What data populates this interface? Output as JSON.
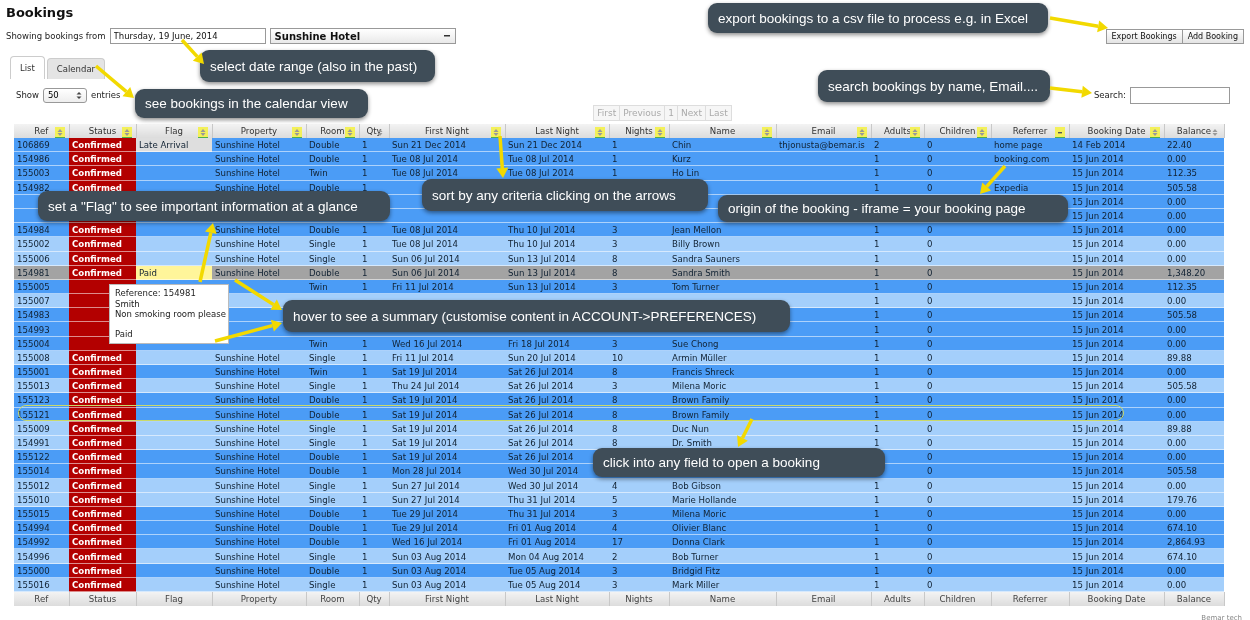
{
  "page_title": "Bookings",
  "filter": {
    "label": "Showing bookings from",
    "date": "Thursday, 19 June, 2014",
    "property": "Sunshine Hotel"
  },
  "actions": [
    "Export Bookings",
    "Add Booking"
  ],
  "tabs": [
    {
      "label": "List",
      "selected": true
    },
    {
      "label": "Calendar",
      "selected": false
    }
  ],
  "page_length": {
    "label_before": "Show",
    "value": "50",
    "label_after": "entries"
  },
  "pagination": [
    {
      "label": "First",
      "disabled": true
    },
    {
      "label": "Previous",
      "disabled": true
    },
    {
      "label": "1",
      "disabled": true
    },
    {
      "label": "Next",
      "disabled": true
    },
    {
      "label": "Last",
      "disabled": true
    }
  ],
  "search": {
    "label": "Search:"
  },
  "table": {
    "columns": [
      {
        "label": "Ref",
        "kind": "text",
        "sort_highlight": true,
        "sorted": false
      },
      {
        "label": "Status",
        "kind": "status",
        "sort_highlight": true,
        "sorted": false
      },
      {
        "label": "Flag",
        "kind": "flag",
        "sort_highlight": true,
        "sorted": false
      },
      {
        "label": "Property",
        "kind": "text",
        "sort_highlight": true,
        "sorted": false
      },
      {
        "label": "Room",
        "kind": "text",
        "sort_highlight": true,
        "sorted": false
      },
      {
        "label": "Qty",
        "kind": "text",
        "sort_highlight": false,
        "sorted": false
      },
      {
        "label": "First Night",
        "kind": "text",
        "sort_highlight": true,
        "sorted": false
      },
      {
        "label": "Last Night",
        "kind": "text",
        "sort_highlight": true,
        "sorted": false
      },
      {
        "label": "Nights",
        "kind": "text",
        "sort_highlight": true,
        "sorted": false
      },
      {
        "label": "Name",
        "kind": "text",
        "sort_highlight": true,
        "sorted": false
      },
      {
        "label": "Email",
        "kind": "text",
        "sort_highlight": true,
        "sorted": false
      },
      {
        "label": "Adults",
        "kind": "text",
        "sort_highlight": true,
        "sorted": false
      },
      {
        "label": "Children",
        "kind": "text",
        "sort_highlight": true,
        "sorted": false
      },
      {
        "label": "Referrer",
        "kind": "text",
        "sort_highlight": true,
        "sorted": true
      },
      {
        "label": "Booking Date",
        "kind": "text",
        "sort_highlight": true,
        "sorted": false
      },
      {
        "label": "Balance",
        "kind": "text",
        "sort_highlight": false,
        "sorted": false
      }
    ],
    "rows": [
      {
        "color": "#4b9cf6",
        "cells": {
          "ref": "106869",
          "status": "Confirmed",
          "flag": {
            "text": "Late Arrival",
            "color": "#dedede"
          },
          "property": "Sunshine Hotel",
          "room": "Double",
          "qty": "1",
          "first": "Sun 21 Dec 2014",
          "last": "Sun 21 Dec 2014",
          "nights": "1",
          "name": "Chin",
          "email": "thjonusta@bemar.is",
          "adults": "2",
          "children": "0",
          "referrer": "home page",
          "booked": "14 Feb 2014",
          "balance": "22.40"
        }
      },
      {
        "color": "#4b9cf6",
        "cells": {
          "ref": "154986",
          "status": "Confirmed",
          "property": "Sunshine Hotel",
          "room": "Double",
          "qty": "1",
          "first": "Tue 08 Jul 2014",
          "last": "Tue 08 Jul 2014",
          "nights": "1",
          "name": "Kurz",
          "adults": "1",
          "children": "0",
          "referrer": "booking.com",
          "booked": "15 Jun 2014",
          "balance": "0.00"
        }
      },
      {
        "color": "#4b9cf6",
        "cells": {
          "ref": "155003",
          "status": "Confirmed",
          "property": "Sunshine Hotel",
          "room": "Twin",
          "qty": "1",
          "first": "Tue 08 Jul 2014",
          "last": "Tue 08 Jul 2014",
          "nights": "1",
          "name": "Ho Lin",
          "adults": "1",
          "children": "0",
          "booked": "15 Jun 2014",
          "balance": "112.35"
        }
      },
      {
        "color": "#4b9cf6",
        "cells": {
          "ref": "154982",
          "status": "Confirmed",
          "property": "Sunshine Hotel",
          "room": "Double",
          "qty": "1",
          "adults": "1",
          "children": "0",
          "referrer": "Expedia",
          "booked": "15 Jun 2014",
          "balance": "505.58"
        }
      },
      {
        "color": "#4b9cf6",
        "cells": {
          "booked": "15 Jun 2014",
          "balance": "0.00"
        }
      },
      {
        "color": "#4b9cf6",
        "cells": {
          "booked": "15 Jun 2014",
          "balance": "0.00"
        }
      },
      {
        "color": "#4b9cf6",
        "cells": {
          "ref": "154984",
          "status": "Confirmed",
          "property": "Sunshine Hotel",
          "room": "Double",
          "qty": "1",
          "first": "Tue 08 Jul 2014",
          "last": "Thu 10 Jul 2014",
          "nights": "3",
          "name": "Jean Mellon",
          "adults": "1",
          "children": "0",
          "booked": "15 Jun 2014",
          "balance": "0.00"
        }
      },
      {
        "color": "#a4cffb",
        "cells": {
          "ref": "155002",
          "status": "Confirmed",
          "property": "Sunshine Hotel",
          "room": "Single",
          "qty": "1",
          "first": "Tue 08 Jul 2014",
          "last": "Thu 10 Jul 2014",
          "nights": "3",
          "name": "Billy Brown",
          "adults": "1",
          "children": "0",
          "booked": "15 Jun 2014",
          "balance": "0.00"
        }
      },
      {
        "color": "#a4cffb",
        "cells": {
          "ref": "155006",
          "status": "Confirmed",
          "property": "Sunshine Hotel",
          "room": "Single",
          "qty": "1",
          "first": "Sun 06 Jul 2014",
          "last": "Sun 13 Jul 2014",
          "nights": "8",
          "name": "Sandra Sauners",
          "adults": "1",
          "children": "0",
          "booked": "15 Jun 2014",
          "balance": "0.00"
        }
      },
      {
        "color": "#a3a3a3",
        "cells": {
          "ref": "154981",
          "status": "Confirmed",
          "flag": {
            "text": "Paid",
            "color": "#fff59a"
          },
          "property": "Sunshine Hotel",
          "room": "Double",
          "qty": "1",
          "first": "Sun 06 Jul 2014",
          "last": "Sun 13 Jul 2014",
          "nights": "8",
          "name": "Sandra Smith",
          "adults": "1",
          "children": "0",
          "booked": "15 Jun 2014",
          "balance": "1,348.20"
        }
      },
      {
        "color": "#4b9cf6",
        "cells": {
          "ref": "155005",
          "room": "Twin",
          "qty": "1",
          "first": "Fri 11 Jul 2014",
          "last": "Sun 13 Jul 2014",
          "nights": "3",
          "name": "Tom Turner",
          "adults": "1",
          "children": "0",
          "booked": "15 Jun 2014",
          "balance": "112.35"
        }
      },
      {
        "color": "#a4cffb",
        "cells": {
          "ref": "155007",
          "adults": "1",
          "children": "0",
          "booked": "15 Jun 2014",
          "balance": "0.00"
        }
      },
      {
        "color": "#4b9cf6",
        "cells": {
          "ref": "154983",
          "adults": "1",
          "children": "0",
          "booked": "15 Jun 2014",
          "balance": "505.58"
        }
      },
      {
        "color": "#4b9cf6",
        "cells": {
          "ref": "154993",
          "adults": "1",
          "children": "0",
          "booked": "15 Jun 2014",
          "balance": "0.00"
        }
      },
      {
        "color": "#4b9cf6",
        "cells": {
          "ref": "155004",
          "room": "Twin",
          "qty": "1",
          "first": "Wed 16 Jul 2014",
          "last": "Fri 18 Jul 2014",
          "nights": "3",
          "name": "Sue Chong",
          "adults": "1",
          "children": "0",
          "booked": "15 Jun 2014",
          "balance": "0.00"
        }
      },
      {
        "color": "#a4cffb",
        "cells": {
          "ref": "155008",
          "status": "Confirmed",
          "property": "Sunshine Hotel",
          "room": "Single",
          "qty": "1",
          "first": "Fri 11 Jul 2014",
          "last": "Sun 20 Jul 2014",
          "nights": "10",
          "name": "Armin Müller",
          "adults": "1",
          "children": "0",
          "booked": "15 Jun 2014",
          "balance": "89.88"
        }
      },
      {
        "color": "#4b9cf6",
        "cells": {
          "ref": "155001",
          "status": "Confirmed",
          "property": "Sunshine Hotel",
          "room": "Twin",
          "qty": "1",
          "first": "Sat 19 Jul 2014",
          "last": "Sat 26 Jul 2014",
          "nights": "8",
          "name": "Francis Shreck",
          "adults": "1",
          "children": "0",
          "booked": "15 Jun 2014",
          "balance": "0.00"
        }
      },
      {
        "color": "#a4cffb",
        "cells": {
          "ref": "155013",
          "status": "Confirmed",
          "property": "Sunshine Hotel",
          "room": "Single",
          "qty": "1",
          "first": "Thu 24 Jul 2014",
          "last": "Sat 26 Jul 2014",
          "nights": "3",
          "name": "Milena Moric",
          "adults": "1",
          "children": "0",
          "booked": "15 Jun 2014",
          "balance": "505.58"
        }
      },
      {
        "color": "#4b9cf6",
        "cells": {
          "ref": "155123",
          "status": "Confirmed",
          "property": "Sunshine Hotel",
          "room": "Double",
          "qty": "1",
          "first": "Sat 19 Jul 2014",
          "last": "Sat 26 Jul 2014",
          "nights": "8",
          "name": "Brown Family",
          "adults": "1",
          "children": "0",
          "booked": "15 Jun 2014",
          "balance": "0.00"
        }
      },
      {
        "color": "#4b9cf6",
        "cells": {
          "ref": "155121",
          "status": "Confirmed",
          "property": "Sunshine Hotel",
          "room": "Double",
          "qty": "1",
          "first": "Sat 19 Jul 2014",
          "last": "Sat 26 Jul 2014",
          "nights": "8",
          "name": "Brown Family",
          "adults": "1",
          "children": "0",
          "booked": "15 Jun 2014",
          "balance": "0.00"
        }
      },
      {
        "color": "#a4cffb",
        "cells": {
          "ref": "155009",
          "status": "Confirmed",
          "property": "Sunshine Hotel",
          "room": "Single",
          "qty": "1",
          "first": "Sat 19 Jul 2014",
          "last": "Sat 26 Jul 2014",
          "nights": "8",
          "name": "Duc Nun",
          "adults": "1",
          "children": "0",
          "booked": "15 Jun 2014",
          "balance": "89.88"
        }
      },
      {
        "color": "#a4cffb",
        "cells": {
          "ref": "154991",
          "status": "Confirmed",
          "property": "Sunshine Hotel",
          "room": "Single",
          "qty": "1",
          "first": "Sat 19 Jul 2014",
          "last": "Sat 26 Jul 2014",
          "nights": "8",
          "name": "Dr. Smith",
          "adults": "1",
          "children": "0",
          "booked": "15 Jun 2014",
          "balance": "0.00"
        }
      },
      {
        "color": "#4b9cf6",
        "cells": {
          "ref": "155122",
          "status": "Confirmed",
          "property": "Sunshine Hotel",
          "room": "Double",
          "qty": "1",
          "first": "Sat 19 Jul 2014",
          "last": "Sat 26 Jul 2014",
          "children": "0",
          "booked": "15 Jun 2014",
          "balance": "0.00"
        }
      },
      {
        "color": "#4b9cf6",
        "cells": {
          "ref": "155014",
          "status": "Confirmed",
          "property": "Sunshine Hotel",
          "room": "Double",
          "qty": "1",
          "first": "Mon 28 Jul 2014",
          "last": "Wed 30 Jul 2014",
          "children": "0",
          "booked": "15 Jun 2014",
          "balance": "505.58"
        }
      },
      {
        "color": "#a4cffb",
        "cells": {
          "ref": "155012",
          "status": "Confirmed",
          "property": "Sunshine Hotel",
          "room": "Single",
          "qty": "1",
          "first": "Sun 27 Jul 2014",
          "last": "Wed 30 Jul 2014",
          "nights": "4",
          "name": "Bob Gibson",
          "adults": "1",
          "children": "0",
          "booked": "15 Jun 2014",
          "balance": "0.00"
        }
      },
      {
        "color": "#a4cffb",
        "cells": {
          "ref": "155010",
          "status": "Confirmed",
          "property": "Sunshine Hotel",
          "room": "Single",
          "qty": "1",
          "first": "Sun 27 Jul 2014",
          "last": "Thu 31 Jul 2014",
          "nights": "5",
          "name": "Marie Hollande",
          "adults": "1",
          "children": "0",
          "booked": "15 Jun 2014",
          "balance": "179.76"
        }
      },
      {
        "color": "#4b9cf6",
        "cells": {
          "ref": "155015",
          "status": "Confirmed",
          "property": "Sunshine Hotel",
          "room": "Double",
          "qty": "1",
          "first": "Tue 29 Jul 2014",
          "last": "Thu 31 Jul 2014",
          "nights": "3",
          "name": "Milena Moric",
          "adults": "1",
          "children": "0",
          "booked": "15 Jun 2014",
          "balance": "0.00"
        }
      },
      {
        "color": "#4b9cf6",
        "cells": {
          "ref": "154994",
          "status": "Confirmed",
          "property": "Sunshine Hotel",
          "room": "Double",
          "qty": "1",
          "first": "Tue 29 Jul 2014",
          "last": "Fri 01 Aug 2014",
          "nights": "4",
          "name": "Olivier Blanc",
          "adults": "1",
          "children": "0",
          "booked": "15 Jun 2014",
          "balance": "674.10"
        }
      },
      {
        "color": "#4b9cf6",
        "cells": {
          "ref": "154992",
          "status": "Confirmed",
          "property": "Sunshine Hotel",
          "room": "Double",
          "qty": "1",
          "first": "Wed 16 Jul 2014",
          "last": "Fri 01 Aug 2014",
          "nights": "17",
          "name": "Donna Clark",
          "adults": "1",
          "children": "0",
          "booked": "15 Jun 2014",
          "balance": "2,864.93"
        }
      },
      {
        "color": "#a4cffb",
        "cells": {
          "ref": "154996",
          "status": "Confirmed",
          "property": "Sunshine Hotel",
          "room": "Single",
          "qty": "1",
          "first": "Sun 03 Aug 2014",
          "last": "Mon 04 Aug 2014",
          "nights": "2",
          "name": "Bob Turner",
          "adults": "1",
          "children": "0",
          "booked": "15 Jun 2014",
          "balance": "674.10"
        }
      },
      {
        "color": "#4b9cf6",
        "cells": {
          "ref": "155000",
          "status": "Confirmed",
          "property": "Sunshine Hotel",
          "room": "Double",
          "qty": "1",
          "first": "Sun 03 Aug 2014",
          "last": "Tue 05 Aug 2014",
          "nights": "3",
          "name": "Bridgid Fitz",
          "adults": "1",
          "children": "0",
          "booked": "15 Jun 2014",
          "balance": "0.00"
        }
      },
      {
        "color": "#a4cffb",
        "cells": {
          "ref": "155016",
          "status": "Confirmed",
          "property": "Sunshine Hotel",
          "room": "Single",
          "qty": "1",
          "first": "Sun 03 Aug 2014",
          "last": "Tue 05 Aug 2014",
          "nights": "3",
          "name": "Mark Miller",
          "adults": "1",
          "children": "0",
          "booked": "15 Jun 2014",
          "balance": "0.00"
        }
      }
    ],
    "footer": [
      "Ref",
      "Status",
      "Flag",
      "Property",
      "Room",
      "Qty",
      "First Night",
      "Last Night",
      "Nights",
      "Name",
      "Email",
      "Adults",
      "Children",
      "Referrer",
      "Booking Date",
      "Balance"
    ]
  },
  "tooltip": {
    "lines": [
      "Reference: 154981",
      "Smith",
      "Non smoking room please",
      "Paid"
    ]
  },
  "annotations": [
    "export bookings to a csv file to process e.g. in Excel",
    "select date range (also in the past)",
    "see bookings in the calendar view",
    "search bookings by name, Email....",
    "sort by any criteria clicking on the arrows",
    "set a \"Flag\" to see important information at a glance",
    "origin of the booking - iframe = your booking page",
    "hover to see a summary (customise content in ACCOUNT->PREFERENCES)",
    "click into any field to open a booking"
  ],
  "credit": "Bemar tech"
}
